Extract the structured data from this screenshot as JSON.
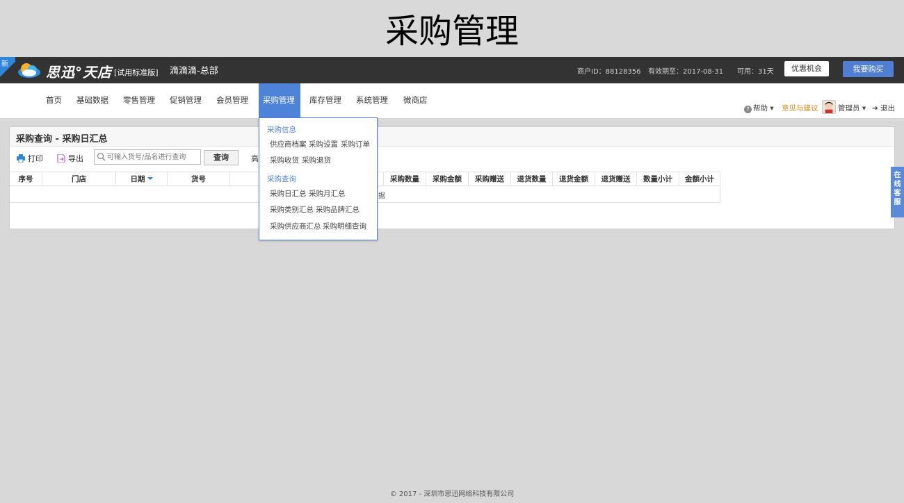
{
  "slide_title": "采购管理",
  "topbar": {
    "badge": "新",
    "brand": "思迅°天店",
    "version": "[试用标准版]",
    "store": "滴滴滴-总部",
    "merchant": "商户ID：88128356",
    "expiry": "有效期至：2017-08-31",
    "available": "可用：31天",
    "offer_button": "优惠机会",
    "buy_button": "我要购买"
  },
  "nav": {
    "items": [
      {
        "label": "首页"
      },
      {
        "label": "基础数据"
      },
      {
        "label": "零售管理"
      },
      {
        "label": "促销管理"
      },
      {
        "label": "会员管理"
      },
      {
        "label": "采购管理"
      },
      {
        "label": "库存管理"
      },
      {
        "label": "系统管理"
      },
      {
        "label": "微商店"
      }
    ],
    "help": "帮助",
    "feedback": "意见与建议",
    "admin": "管理员",
    "logout": "退出"
  },
  "panel": {
    "title": "采购查询 - 采购日汇总",
    "print": "打印",
    "export": "导出",
    "search_placeholder": "可输入货号/品名进行查询",
    "query_button": "查询",
    "advanced": "高",
    "no_data": "据",
    "columns": [
      "序号",
      "门店",
      "日期",
      "货号",
      "",
      "采购数量",
      "采购金额",
      "采购赠送",
      "退货数量",
      "退货金额",
      "退货赠送",
      "数量小计",
      "金额小计"
    ]
  },
  "dropdown": {
    "section1": "采购信息",
    "section1_items": [
      "供应商档案",
      "采购设置",
      "采购订单",
      "采购收货",
      "采购退货"
    ],
    "section2": "采购查询",
    "section2_items": [
      "采购日汇总",
      "采购月汇总",
      "采购类别汇总",
      "采购品牌汇总",
      "采购供应商汇总",
      "采购明细查询"
    ]
  },
  "chat": "在线客服",
  "footer": "© 2017 - 深圳市思迅网络科技有限公司",
  "colors": {
    "topbar": "#333333",
    "accent": "#4f82d9",
    "feedback": "#d48b1f"
  }
}
